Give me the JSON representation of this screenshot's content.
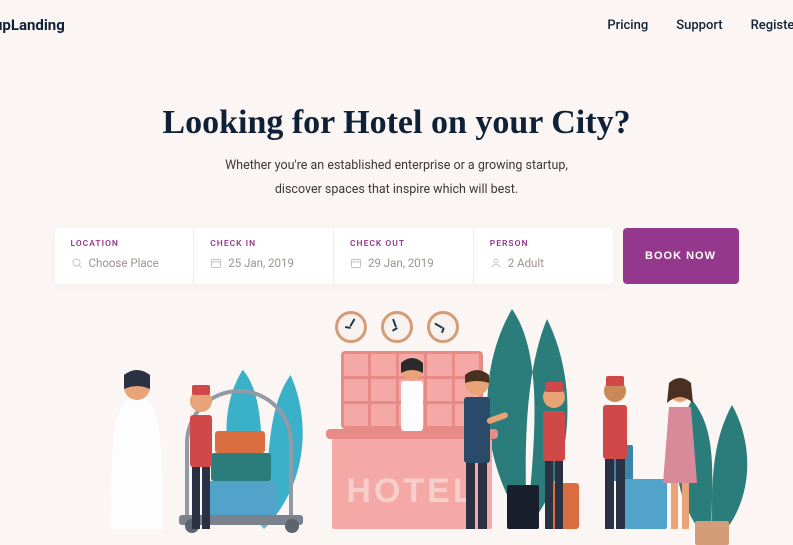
{
  "header": {
    "logo": "upLanding",
    "nav": [
      "Pricing",
      "Support",
      "Register"
    ]
  },
  "hero": {
    "title": "Looking for Hotel on your City?",
    "subtitle1": "Whether you're an established enterprise or a growing startup,",
    "subtitle2": "discover spaces that inspire which will best."
  },
  "search": {
    "location": {
      "label": "LOCATION",
      "placeholder": "Choose Place"
    },
    "checkin": {
      "label": "CHECK IN",
      "value": "25 Jan, 2019"
    },
    "checkout": {
      "label": "CHECK OUT",
      "value": "29 Jan, 2019"
    },
    "person": {
      "label": "PERSON",
      "value": "2 Adult"
    },
    "button": "BOOK NOW"
  },
  "illustration": {
    "hotel_sign": "HOTEL"
  },
  "colors": {
    "accent": "#94388e",
    "text": "#0f2137",
    "background": "#fbf6f3"
  }
}
